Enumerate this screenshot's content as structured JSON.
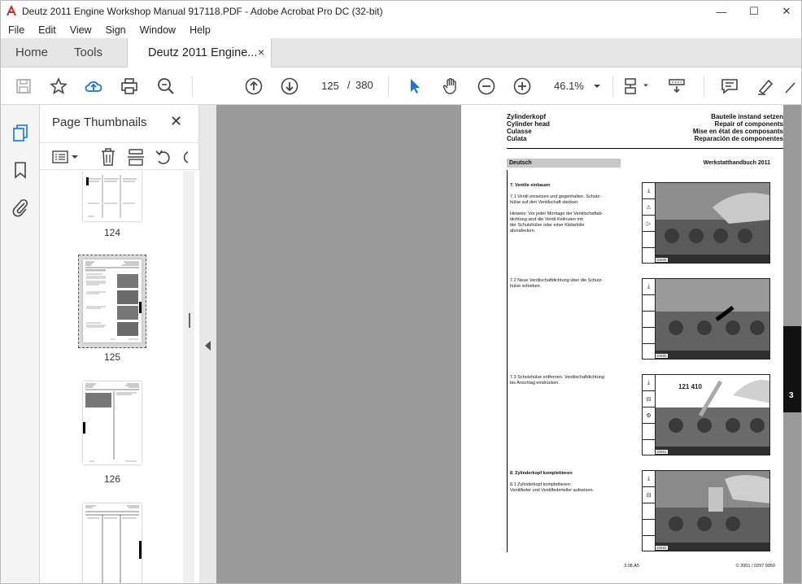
{
  "window": {
    "title": "Deutz 2011 Engine Workshop Manual 917118.PDF - Adobe Acrobat Pro DC (32-bit)",
    "minimize": "—",
    "maximize": "☐",
    "close": "✕"
  },
  "menu": [
    "File",
    "Edit",
    "View",
    "Sign",
    "Window",
    "Help"
  ],
  "tabs": {
    "home": "Home",
    "tools": "Tools",
    "doc": "Deutz 2011 Engine...",
    "close": "×"
  },
  "toolbar": {
    "page_current": "125",
    "page_sep": "/",
    "page_total": "380",
    "zoom": "46.1%"
  },
  "panel": {
    "title": "Page Thumbnails",
    "close": "✕",
    "thumbs": [
      {
        "label": "124"
      },
      {
        "label": "125",
        "selected": true
      },
      {
        "label": "126"
      },
      {
        "label": ""
      }
    ]
  },
  "page": {
    "header_left": [
      "Zylinderkopf",
      "Cylinder head",
      "Culasse",
      "Culata"
    ],
    "header_right": [
      "Bauteile instand setzen",
      "Repair of components",
      "Mise en état des composants",
      "Reparación de componentes"
    ],
    "lang": "Deutsch",
    "manual": "Werkstatthandbuch 2011",
    "sections": [
      {
        "lines": [
          "7.    Ventile einbauen",
          "",
          "7.1   Ventil einsetzen und gegenhalten. Schutz-",
          "      hülse auf den Ventilschaft stecken.",
          "",
          "Hinweis:  Vor jeder Montage der Ventilschaftab-",
          "          dichtung sind die Ventil-Keilnuten mit",
          "          der Schutzhülse oder einer Klebefolie",
          "          abzudecken."
        ],
        "photo_code": "30889"
      },
      {
        "lines": [
          "7.2   Neue Ventilschaftdichtung über die Schutz-",
          "      hülse schieben."
        ],
        "photo_code": "30890"
      },
      {
        "lines": [
          "7.3   Schutzhülse entfernen. Ventilschaftdichtung",
          "      bis Anschlag eindrücken."
        ],
        "photo_code": "30891",
        "photo_label": "121 410"
      },
      {
        "lines": [
          "8.    Zylinderkopf komplettieren",
          "",
          "8.1   Zylinderkopf komplettieren:",
          "      Ventilfeder und Ventilfederteller aufsetzen."
        ],
        "photo_code": "30892"
      }
    ],
    "footer_center": "3.08.A5",
    "footer_right": "© 2001 / 0297 9959",
    "side_tab": "3"
  }
}
